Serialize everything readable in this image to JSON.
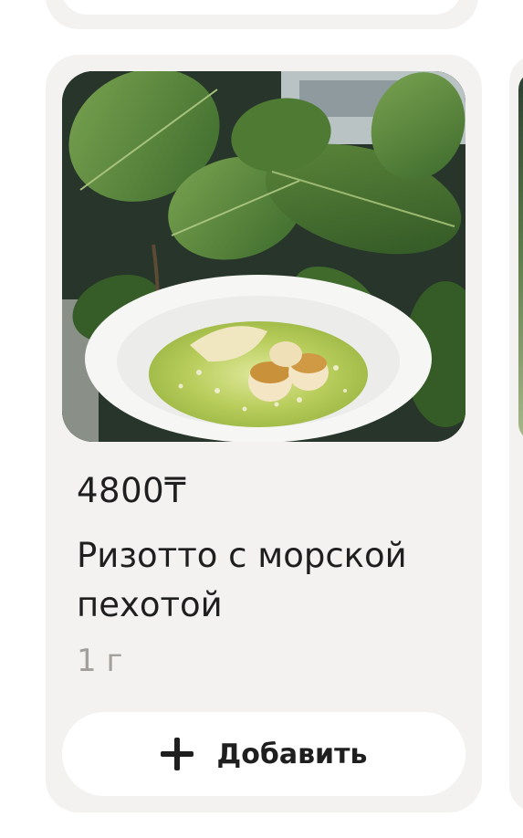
{
  "product": {
    "price": "4800₸",
    "title": "Ризотто с морской пехотой",
    "weight": "1 г",
    "photo_icon": "risotto-with-scallops-photo"
  },
  "actions": {
    "add_label": "Добавить",
    "add_icon": "plus-icon"
  },
  "colors": {
    "card_background": "#f3f2f0",
    "button_background": "#ffffff",
    "text_primary": "#1f1f1f",
    "text_secondary": "#a3a09c"
  }
}
